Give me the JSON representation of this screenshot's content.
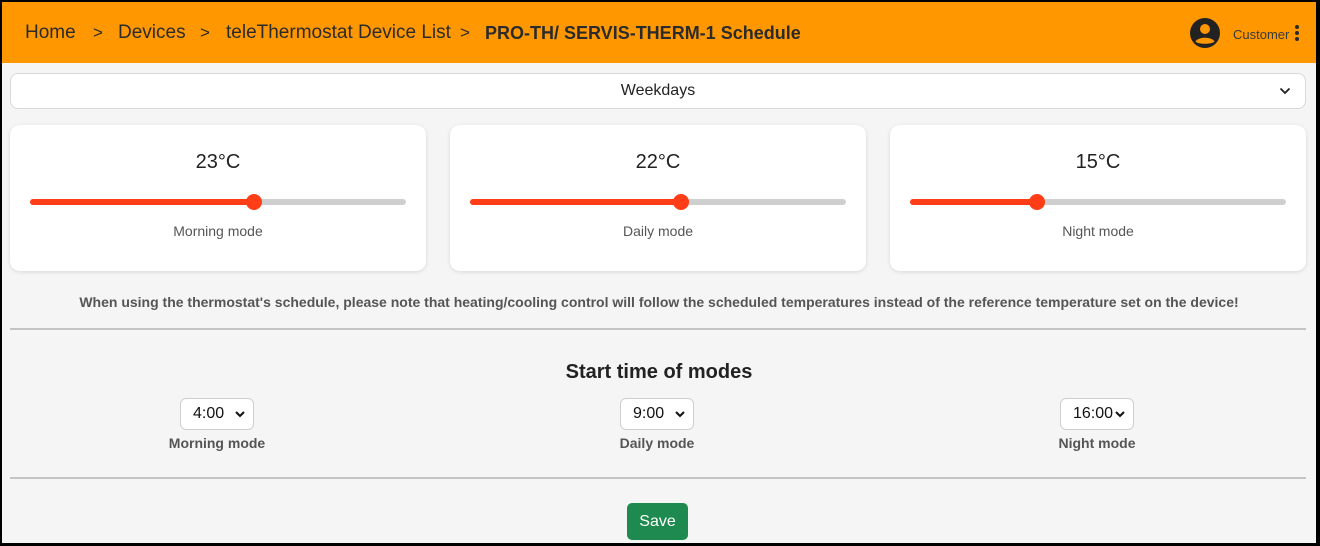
{
  "breadcrumb": {
    "items": [
      "Home",
      "Devices",
      "teleThermostat Device List",
      "PRO-TH/ SERVIS-THERM-1 Schedule"
    ],
    "separator": ">"
  },
  "user": {
    "label": "Customer"
  },
  "day_select": {
    "value": "Weekdays"
  },
  "modes": [
    {
      "temp": "23°C",
      "label": "Morning mode",
      "level_percent": 59.6
    },
    {
      "temp": "22°C",
      "label": "Daily mode",
      "level_percent": 56.1
    },
    {
      "temp": "15°C",
      "label": "Night mode",
      "level_percent": 33.8
    }
  ],
  "note": "When using the thermostat's schedule, please note that heating/cooling control will follow the scheduled temperatures instead of the reference temperature set on the device!",
  "start_times": {
    "title": "Start time of modes",
    "items": [
      {
        "value": "4:00",
        "label": "Morning mode"
      },
      {
        "value": "9:00",
        "label": "Daily mode"
      },
      {
        "value": "16:00",
        "label": "Night mode"
      }
    ]
  },
  "save_label": "Save",
  "colors": {
    "header": "#ff9800",
    "slider": "#ff3d17",
    "save": "#1e8a4f"
  }
}
